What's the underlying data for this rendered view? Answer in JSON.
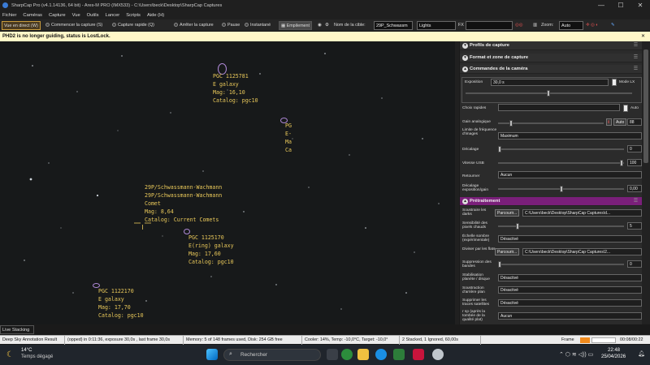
{
  "window": {
    "title": "SharpCap Pro (v4.1.14136, 64 bit) - Ares-M PRO (IMX533) - C:\\Users\\beck\\Desktop\\SharpCap Captures",
    "min": "—",
    "max": "☐",
    "close": "✕"
  },
  "menu": [
    "Fichier",
    "Caméras",
    "Capture",
    "Vue",
    "Outils",
    "Lancer",
    "Scripts",
    "Aide (H)"
  ],
  "toolbar": {
    "live": "Vue en direct (W)",
    "start": "Commencer la capture (S)",
    "quick": "Capture rapide (Q)",
    "stop": "Arrêter la capture",
    "pause": "Pause",
    "snapshot": "Instantané",
    "stack": "Empilement",
    "target_label": "Nom de la cible:",
    "target_value": "29P_Schwassm",
    "frame_type": "Lights",
    "fx_label": "FX",
    "fx_value": "",
    "zoom_label": "Zoom:",
    "zoom_value": "Auto"
  },
  "notice": {
    "text": "PHD2 is no longer guiding, status is LostLock.",
    "close": "✕"
  },
  "annotations": [
    {
      "text": "PGC 1125781\nE galaxy\nMag: 16,10\nCatalog: pgc10"
    },
    {
      "text": "PG\nE-\nMa\nCa"
    },
    {
      "text": "29P/Schwassmann-Wachmann\n29P/Schwassmann-Wachmann\nComet\nMag: 8,64\nCatalog: Current Comets"
    },
    {
      "text": "PGC 1125170\nE(ring) galaxy\nMag: 17,60\nCatalog: pgc10"
    },
    {
      "text": "PGC 1122170\nE galaxy\nMag: 17,70\nCatalog: pgc10"
    }
  ],
  "panel": {
    "sections": {
      "profiles": "Profils de capture",
      "format": "Format et zone de capture",
      "camera": "Commandes de la caméra",
      "preprocess": "Prétraitement"
    },
    "camera": {
      "exposure_label": "Exposition",
      "exposure_value": "30,0 s",
      "lx_label": "Mode LX",
      "quick_label": "Choix rapides",
      "auto_label": "Auto",
      "gain_label": "Gain analogique",
      "gain_auto": "Auto",
      "gain_value": "88",
      "freq_label": "Limite de fréquence d'images",
      "freq_value": "Maximum",
      "offset_label": "Décalage",
      "offset_value": "0",
      "usb_label": "Vitesse USB",
      "usb_value": "100",
      "flip_label": "Retourner",
      "flip_value": "Aucun",
      "expgain_label": "Décalage exposition/gain",
      "expgain_value": "0,00"
    },
    "pre": {
      "darks_label": "Soustraire les darks",
      "browse": "Parcourir...",
      "darks_path": "C:\\Users\\beck\\Desktop\\SharpCap Captures\\d...",
      "hot_label": "Sensibilité des pixels chauds",
      "hot_value": "5",
      "dark_scale_label": "Échelle sombre (expérimentale)",
      "dark_scale_value": "Désactivé",
      "flats_label": "Diviser par les flats",
      "flats_path": "C:\\Users\\beck\\Desktop\\SharpCap Captures\\2...",
      "banding_label": "Suppression des bandes",
      "banding_value": "0",
      "stab_label": "Stabilisation planète / disque",
      "stab_value": "Désactivé",
      "bg_label": "Soustraction d'arrière plan",
      "bg_value": "Désactivé",
      "sat_label": "Supprimer les traces satellites",
      "sat_value": "Désactivé",
      "cf_label": "r sp (après la tombée de la qualité plat)",
      "cf_value": "Aucun"
    }
  },
  "live_stacking": "Live Stacking",
  "status": {
    "s1": "Deep Sky Annotation Result",
    "s2": "(opped) in 0:11:36, exposure 30,0s , last frame 30,0s",
    "s3": "Memory: 5 of 148 frames used, Disk: 254 GB free",
    "s4": "Cooler: 14%, Temp: -10,0°C, Target: -10,0°",
    "s5": "2 Stacked, 1 Ignored, 60,00s",
    "frame_label": "Frame",
    "frame_counter": "00:08/00:22"
  },
  "taskbar": {
    "temp": "14°C",
    "weather": "Temps dégagé",
    "search": "Rechercher",
    "time": "22:48",
    "date": "25/04/2026"
  },
  "colors": {
    "notice": "#fff7c8",
    "annotation": "#e9c85a",
    "preprocess": "#7a1f7a",
    "accent": "#3a7bd5"
  }
}
